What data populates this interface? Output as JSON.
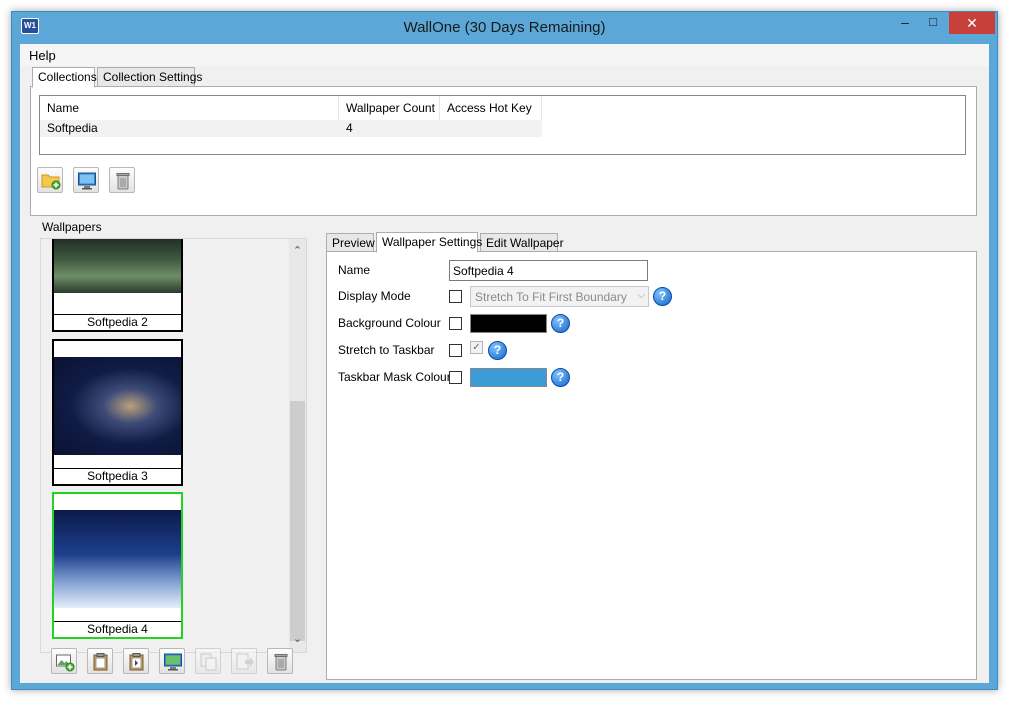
{
  "window": {
    "title": "WallOne (30 Days Remaining)",
    "app_icon_text": "W1",
    "controls": {
      "minimize": "–",
      "maximize": "□",
      "close": "✕"
    }
  },
  "menu": {
    "items": [
      "Help"
    ]
  },
  "top_tabs": [
    {
      "label": "Collections",
      "active": true
    },
    {
      "label": "Collection Settings",
      "active": false
    }
  ],
  "collections": {
    "columns": [
      "Name",
      "Wallpaper Count",
      "Access Hot Key"
    ],
    "rows": [
      {
        "name": "Softpedia",
        "count": "4",
        "hotkey": ""
      }
    ],
    "toolbar": [
      {
        "name": "add-collection-button",
        "icon": "folder-add-icon"
      },
      {
        "name": "set-desktop-button",
        "icon": "monitor-icon"
      },
      {
        "name": "delete-collection-button",
        "icon": "trash-icon"
      }
    ]
  },
  "wallpapers": {
    "group_label": "Wallpapers",
    "items": [
      {
        "caption": "Softpedia 2",
        "selected": false
      },
      {
        "caption": "Softpedia 3",
        "selected": false
      },
      {
        "caption": "Softpedia 4",
        "selected": true
      }
    ],
    "scroll": {
      "up": "⌃",
      "down": "⌄"
    },
    "toolbar": [
      {
        "name": "add-wallpaper-button",
        "icon": "image-add-icon",
        "enabled": true
      },
      {
        "name": "paste-button",
        "icon": "clipboard-icon",
        "enabled": true
      },
      {
        "name": "paste-special-button",
        "icon": "clipboard-arrow-icon",
        "enabled": true
      },
      {
        "name": "preview-desktop-button",
        "icon": "monitor-icon",
        "enabled": true
      },
      {
        "name": "copy-button",
        "icon": "copy-icon",
        "enabled": false
      },
      {
        "name": "move-button",
        "icon": "move-icon",
        "enabled": false
      },
      {
        "name": "delete-wallpaper-button",
        "icon": "trash-icon",
        "enabled": true
      }
    ]
  },
  "right_tabs": [
    {
      "label": "Preview",
      "active": false
    },
    {
      "label": "Wallpaper Settings",
      "active": true
    },
    {
      "label": "Edit Wallpaper",
      "active": false
    }
  ],
  "settings": {
    "name_label": "Name",
    "name_value": "Softpedia 4",
    "display_mode_label": "Display Mode",
    "display_mode_value": "Stretch To Fit First Boundary",
    "background_colour_label": "Background Colour",
    "background_colour": "#000000",
    "stretch_label": "Stretch to Taskbar",
    "stretch_checked_mark": "✓",
    "taskbar_mask_label": "Taskbar Mask Colour",
    "taskbar_mask_colour": "#3d9bd6",
    "help_glyph": "?"
  },
  "colors": {
    "accent": "#5aa7d8",
    "close_button": "#c7413a",
    "selection": "#22d422"
  }
}
